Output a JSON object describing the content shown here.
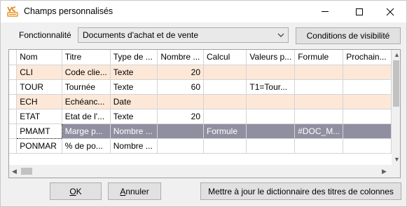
{
  "window": {
    "title": "Champs personnalisés",
    "accent_color": "#e08000"
  },
  "toolbar": {
    "functionality_label": "Fonctionnalité",
    "functionality_value": "Documents d'achat et de vente",
    "visibility_button": "Conditions de visibilité"
  },
  "grid": {
    "columns": [
      "Nom",
      "Titre",
      "Type de ...",
      "Nombre ...",
      "Calcul",
      "Valeurs p...",
      "Formule",
      "Prochain..."
    ],
    "rows": [
      {
        "nom": "CLI",
        "titre": "Code clie...",
        "type": "Texte",
        "nombre": "20",
        "calcul": "",
        "valeurs": "",
        "formule": "",
        "prochain": ""
      },
      {
        "nom": "TOUR",
        "titre": "Tournée",
        "type": "Texte",
        "nombre": "60",
        "calcul": "",
        "valeurs": "T1=Tour...",
        "formule": "",
        "prochain": ""
      },
      {
        "nom": "ECH",
        "titre": "Echéanc...",
        "type": "Date",
        "nombre": "",
        "calcul": "",
        "valeurs": "",
        "formule": "",
        "prochain": ""
      },
      {
        "nom": "ETAT",
        "titre": "Etat de l'...",
        "type": "Texte",
        "nombre": "20",
        "calcul": "",
        "valeurs": "",
        "formule": "",
        "prochain": ""
      },
      {
        "nom": "PMAMT",
        "titre": "Marge p...",
        "type": "Nombre ...",
        "nombre": "",
        "calcul": "Formule",
        "valeurs": "",
        "formule": "#DOC_M...",
        "prochain": ""
      },
      {
        "nom": "PONMAR",
        "titre": "% de po...",
        "type": "Nombre ...",
        "nombre": "",
        "calcul": "",
        "valeurs": "",
        "formule": "",
        "prochain": ""
      }
    ]
  },
  "footer": {
    "ok_accel": "O",
    "ok_rest": "K",
    "cancel_accel": "A",
    "cancel_rest": "nnuler",
    "dictionary_button": "Mettre à jour le dictionnaire des titres de colonnes"
  }
}
